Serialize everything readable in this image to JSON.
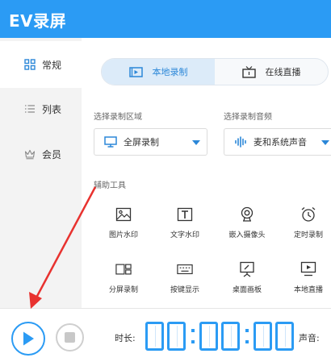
{
  "app": {
    "title": "EV录屏"
  },
  "colors": {
    "accent": "#2b9bf4",
    "arrow": "#e8322f",
    "sidebar_bg": "#f3f3f3"
  },
  "sidebar": {
    "items": [
      {
        "label": "常规",
        "icon": "grid-icon",
        "active": true
      },
      {
        "label": "列表",
        "icon": "list-icon",
        "active": false
      },
      {
        "label": "会员",
        "icon": "crown-icon",
        "active": false
      }
    ]
  },
  "tabs": [
    {
      "label": "本地录制",
      "icon": "local-record-icon",
      "active": true
    },
    {
      "label": "在线直播",
      "icon": "tv-icon",
      "active": false
    }
  ],
  "capture": {
    "area_label": "选择录制区域",
    "area_value": "全屏录制",
    "audio_label": "选择录制音频",
    "audio_value": "麦和系统声音"
  },
  "tools": {
    "section_label": "辅助工具",
    "items": [
      {
        "label": "图片水印",
        "icon": "image-icon"
      },
      {
        "label": "文字水印",
        "icon": "text-icon"
      },
      {
        "label": "嵌入摄像头",
        "icon": "webcam-icon"
      },
      {
        "label": "定时录制",
        "icon": "alarm-clock-icon"
      },
      {
        "label": "分屏录制",
        "icon": "split-screen-icon"
      },
      {
        "label": "按键显示",
        "icon": "keyboard-icon"
      },
      {
        "label": "桌面画板",
        "icon": "drawing-board-icon"
      },
      {
        "label": "本地直播",
        "icon": "monitor-play-icon"
      }
    ]
  },
  "bottom": {
    "duration_label": "时长:",
    "timer": "00:00:00",
    "volume_label": "声音:"
  }
}
